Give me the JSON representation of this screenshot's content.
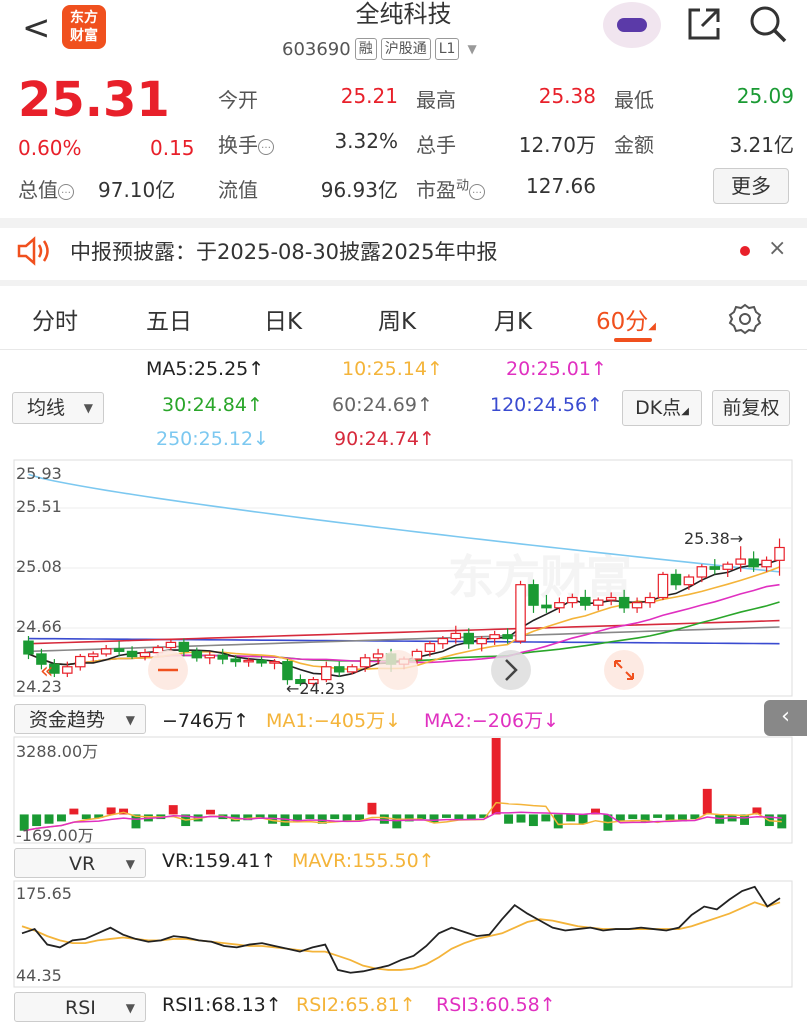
{
  "header": {
    "back": "<",
    "logo_line1": "东方",
    "logo_line2": "财富",
    "stock_name": "全纯科技",
    "code": "603690",
    "tags": [
      "融",
      "沪股通",
      "L1"
    ],
    "dropdown": "▼"
  },
  "quote": {
    "price": "25.31",
    "change_pct": "0.60%",
    "change": "0.15",
    "mktcap_label": "总值",
    "mktcap": "97.10亿",
    "open_label": "今开",
    "open": "25.21",
    "high_label": "最高",
    "high": "25.38",
    "low_label": "最低",
    "low": "25.09",
    "turnover_label": "换手",
    "turnover": "3.32%",
    "volume_label": "总手",
    "volume": "12.70万",
    "amount_label": "金额",
    "amount": "3.21亿",
    "float_label": "流值",
    "float": "96.93亿",
    "pe_label": "市盈",
    "pe_sup": "动",
    "pe": "127.66",
    "more": "更多",
    "info_icon": "…"
  },
  "notice": {
    "text": "中报预披露：于2025-08-30披露2025年中报",
    "close": "×"
  },
  "tabs": [
    "分时",
    "五日",
    "日K",
    "周K",
    "月K",
    "60分"
  ],
  "active_tab": "60分",
  "ma_legend": {
    "selector": "均线",
    "ma5": "MA5:25.25↑",
    "ma10": "10:25.14↑",
    "ma20": "20:25.01↑",
    "ma30": "30:24.84↑",
    "ma60": "60:24.69↑",
    "ma120": "120:24.56↑",
    "ma250": "250:25.12↓",
    "ma90": "90:24.74↑",
    "dk": "DK点",
    "fq": "前复权"
  },
  "colors": {
    "up": "#e8202a",
    "down": "#1a9a33",
    "ma5": "#222222",
    "ma10": "#f4b43a",
    "ma20": "#e030c0",
    "ma30": "#2aa62a",
    "ma60": "#888888",
    "ma120": "#3a4bd0",
    "ma250": "#7cc8f0",
    "ma90": "#d62a3c"
  },
  "chart_data": [
    {
      "type": "candlestick",
      "y_ticks": [
        "25.93",
        "25.51",
        "25.08",
        "24.66",
        "24.23"
      ],
      "ylim": [
        24.23,
        25.93
      ],
      "annotations": {
        "max": "25.38→",
        "min": "←24.23"
      },
      "watermark": "东方财富",
      "candles": [
        [
          24.58,
          24.62,
          24.48,
          24.44
        ],
        [
          24.48,
          24.52,
          24.4,
          24.36
        ],
        [
          24.4,
          24.44,
          24.33,
          24.3
        ],
        [
          24.33,
          24.42,
          24.38,
          24.3
        ],
        [
          24.38,
          24.48,
          24.46,
          24.35
        ],
        [
          24.46,
          24.5,
          24.48,
          24.42
        ],
        [
          24.48,
          24.55,
          24.52,
          24.46
        ],
        [
          24.52,
          24.58,
          24.5,
          24.46
        ],
        [
          24.5,
          24.54,
          24.46,
          24.44
        ],
        [
          24.46,
          24.52,
          24.49,
          24.43
        ],
        [
          24.49,
          24.55,
          24.53,
          24.46
        ],
        [
          24.53,
          24.6,
          24.57,
          24.5
        ],
        [
          24.57,
          24.6,
          24.5,
          24.46
        ],
        [
          24.5,
          24.53,
          24.45,
          24.42
        ],
        [
          24.45,
          24.5,
          24.47,
          24.4
        ],
        [
          24.47,
          24.52,
          24.44,
          24.4
        ],
        [
          24.44,
          24.47,
          24.42,
          24.38
        ],
        [
          24.42,
          24.45,
          24.43,
          24.38
        ],
        [
          24.43,
          24.46,
          24.41,
          24.38
        ],
        [
          24.41,
          24.44,
          24.42,
          24.36
        ],
        [
          24.42,
          24.44,
          24.28,
          24.24
        ],
        [
          24.28,
          24.32,
          24.25,
          24.23
        ],
        [
          24.25,
          24.3,
          24.28,
          24.23
        ],
        [
          24.28,
          24.42,
          24.38,
          24.26
        ],
        [
          24.38,
          24.42,
          24.34,
          24.3
        ],
        [
          24.34,
          24.4,
          24.38,
          24.32
        ],
        [
          24.38,
          24.48,
          24.45,
          24.34
        ],
        [
          24.45,
          24.52,
          24.48,
          24.4
        ],
        [
          24.48,
          24.52,
          24.4,
          24.34
        ],
        [
          24.4,
          24.46,
          24.44,
          24.36
        ],
        [
          24.44,
          24.52,
          24.5,
          24.4
        ],
        [
          24.5,
          24.58,
          24.56,
          24.46
        ],
        [
          24.56,
          24.62,
          24.6,
          24.52
        ],
        [
          24.6,
          24.7,
          24.64,
          24.56
        ],
        [
          24.64,
          24.68,
          24.56,
          24.52
        ],
        [
          24.56,
          24.62,
          24.6,
          24.5
        ],
        [
          24.6,
          24.66,
          24.63,
          24.55
        ],
        [
          24.63,
          24.68,
          24.6,
          24.56
        ],
        [
          24.58,
          25.05,
          25.02,
          24.56
        ],
        [
          25.02,
          25.06,
          24.86,
          24.8
        ],
        [
          24.86,
          24.94,
          24.84,
          24.8
        ],
        [
          24.84,
          24.92,
          24.88,
          24.8
        ],
        [
          24.88,
          24.95,
          24.92,
          24.84
        ],
        [
          24.92,
          24.98,
          24.86,
          24.82
        ],
        [
          24.86,
          24.92,
          24.9,
          24.82
        ],
        [
          24.9,
          24.96,
          24.92,
          24.86
        ],
        [
          24.92,
          24.98,
          24.84,
          24.8
        ],
        [
          24.84,
          24.92,
          24.88,
          24.8
        ],
        [
          24.88,
          24.96,
          24.92,
          24.84
        ],
        [
          24.92,
          25.12,
          25.1,
          24.9
        ],
        [
          25.1,
          25.14,
          25.02,
          24.98
        ],
        [
          25.02,
          25.1,
          25.08,
          24.98
        ],
        [
          25.08,
          25.18,
          25.16,
          25.04
        ],
        [
          25.16,
          25.22,
          25.14,
          25.1
        ],
        [
          25.14,
          25.2,
          25.18,
          25.08
        ],
        [
          25.18,
          25.32,
          25.22,
          25.12
        ],
        [
          25.22,
          25.28,
          25.16,
          25.12
        ],
        [
          25.16,
          25.24,
          25.21,
          25.12
        ],
        [
          25.21,
          25.38,
          25.31,
          25.09
        ]
      ]
    },
    {
      "type": "bar",
      "selector": "资金趋势",
      "value": "−746万↑",
      "ma1": "MA1:−405万↓",
      "ma2": "MA2:−206万↓",
      "y_ticks": [
        "3288.00万",
        "-169.00万"
      ],
      "ylim": [
        -1100,
        3288
      ],
      "values": [
        -700,
        -500,
        -400,
        -300,
        250,
        -200,
        -150,
        300,
        250,
        -600,
        -300,
        -200,
        400,
        -500,
        -300,
        200,
        -200,
        -300,
        -250,
        -150,
        -400,
        -500,
        -300,
        -200,
        -400,
        -200,
        -300,
        -250,
        500,
        -400,
        -600,
        -300,
        -200,
        -350,
        -150,
        -200,
        -250,
        -150,
        3288,
        -400,
        -350,
        -500,
        -300,
        -600,
        -300,
        -400,
        250,
        -700,
        -300,
        -200,
        -350,
        -150,
        -250,
        -300,
        -200,
        1100,
        -400,
        -300,
        -450,
        300,
        -500,
        -600
      ]
    },
    {
      "type": "line",
      "selector": "VR",
      "vr": "VR:159.41↑",
      "mavr": "MAVR:155.50↑"
    },
    {
      "type": "line",
      "selector": "RSI",
      "y_ticks": [
        "175.65",
        "44.35"
      ],
      "ylim": [
        44.35,
        175.65
      ],
      "rsi1": "RSI1:68.13↑",
      "rsi2": "RSI2:65.81↑",
      "rsi3": "RSI3:60.58↑",
      "vr_series": [
        112,
        118,
        96,
        92,
        102,
        104,
        112,
        120,
        110,
        104,
        100,
        102,
        108,
        106,
        102,
        100,
        94,
        92,
        96,
        98,
        94,
        90,
        86,
        92,
        96,
        60,
        56,
        58,
        62,
        66,
        74,
        80,
        94,
        112,
        120,
        114,
        108,
        110,
        132,
        152,
        140,
        130,
        120,
        116,
        118,
        120,
        116,
        118,
        118,
        120,
        118,
        116,
        120,
        138,
        150,
        146,
        160,
        172,
        178,
        150,
        162
      ],
      "mavr_series": [
        122,
        116,
        108,
        102,
        98,
        98,
        102,
        104,
        106,
        104,
        102,
        102,
        104,
        104,
        102,
        100,
        98,
        96,
        94,
        94,
        92,
        90,
        88,
        86,
        86,
        80,
        74,
        66,
        62,
        60,
        60,
        62,
        68,
        78,
        90,
        98,
        104,
        108,
        112,
        120,
        128,
        132,
        130,
        126,
        122,
        120,
        118,
        118,
        118,
        118,
        118,
        118,
        118,
        122,
        128,
        134,
        140,
        148,
        156,
        150,
        156
      ]
    }
  ],
  "icons": [
    "back-arrow-icon",
    "share-icon",
    "search-icon",
    "speaker-icon",
    "gear-icon",
    "collapse-icon",
    "chevron-right-icon",
    "expand-icon",
    "minus-icon",
    "double-left-icon"
  ]
}
